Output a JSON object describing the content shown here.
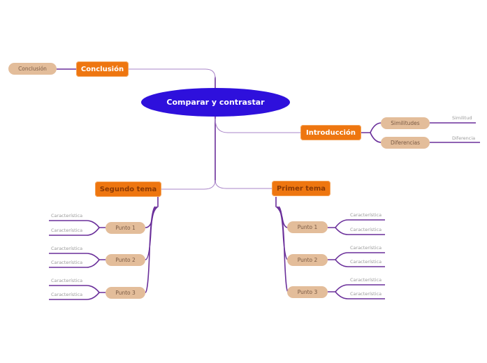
{
  "central": {
    "label": "Comparar y contrastar"
  },
  "branches": {
    "conclusion": {
      "label": "Conclusión",
      "subs": [
        {
          "label": "Conclusión"
        }
      ]
    },
    "introduccion": {
      "label": "Introducción",
      "subs": [
        {
          "label": "Similitudes",
          "leaves": [
            "Similitud"
          ]
        },
        {
          "label": "Diferencias",
          "leaves": [
            "Diferencia"
          ]
        }
      ]
    },
    "segundo": {
      "label": "Segundo tema",
      "subs": [
        {
          "label": "Punto 1",
          "leaves": [
            "Característica",
            "Característica"
          ]
        },
        {
          "label": "Punto 2",
          "leaves": [
            "Característica",
            "Característica"
          ]
        },
        {
          "label": "Punto 3",
          "leaves": [
            "Característica",
            "Característica"
          ]
        }
      ]
    },
    "primer": {
      "label": "Primer tema",
      "subs": [
        {
          "label": "Punto 1",
          "leaves": [
            "Característica",
            "Característica"
          ]
        },
        {
          "label": "Punto 2",
          "leaves": [
            "Característica",
            "Característica"
          ]
        },
        {
          "label": "Punto 3",
          "leaves": [
            "Característica",
            "Característica"
          ]
        }
      ]
    }
  },
  "colors": {
    "central": "#2e10dc",
    "main": "#ee7610",
    "sub": "#e3bd9a",
    "line": "#6a2f9a",
    "line_light": "#a985c8"
  }
}
